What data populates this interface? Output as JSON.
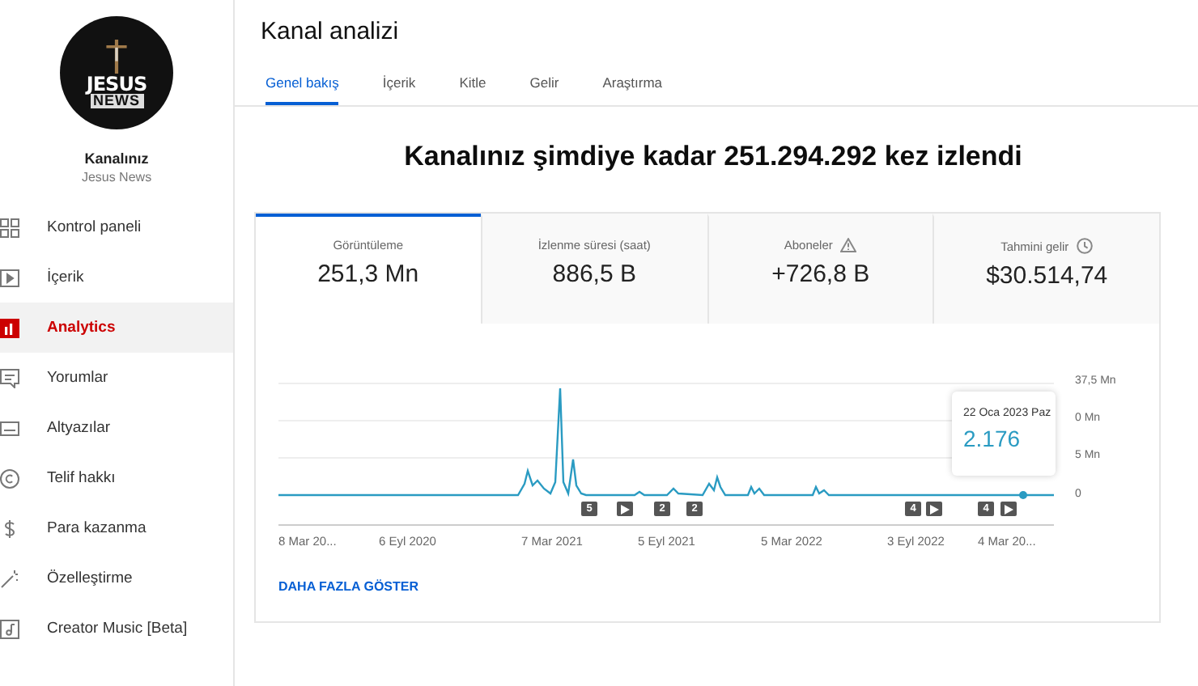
{
  "sidebar": {
    "logo": {
      "line1": "JESUS",
      "line2": "NEWS"
    },
    "channel_label": "Kanalınız",
    "channel_name": "Jesus News",
    "items": [
      {
        "label": "Kontrol paneli",
        "kind": "dashboard",
        "selected": false
      },
      {
        "label": "İçerik",
        "kind": "content",
        "selected": false
      },
      {
        "label": "Analytics",
        "kind": "analytics",
        "selected": true
      },
      {
        "label": "Yorumlar",
        "kind": "comments",
        "selected": false
      },
      {
        "label": "Altyazılar",
        "kind": "subtitles",
        "selected": false
      },
      {
        "label": "Telif hakkı",
        "kind": "copyright",
        "selected": false
      },
      {
        "label": "Para kazanma",
        "kind": "money",
        "selected": false
      },
      {
        "label": "Özelleştirme",
        "kind": "customize",
        "selected": false
      },
      {
        "label": "Creator Music [Beta]",
        "kind": "music",
        "selected": false
      }
    ]
  },
  "header": {
    "title": "Kanal analizi"
  },
  "tabs": [
    {
      "label": "Genel bakış",
      "selected": true
    },
    {
      "label": "İçerik",
      "selected": false
    },
    {
      "label": "Kitle",
      "selected": false
    },
    {
      "label": "Gelir",
      "selected": false
    },
    {
      "label": "Araştırma",
      "selected": false
    }
  ],
  "headline": "Kanalınız şimdiye kadar 251.294.292 kez izlendi",
  "metrics": [
    {
      "label": "Görüntüleme",
      "value": "251,3 Mn",
      "selected": true,
      "kind": "plain"
    },
    {
      "label": "İzlenme süresi (saat)",
      "value": "886,5 B",
      "selected": false,
      "kind": "plain"
    },
    {
      "label": "Aboneler",
      "value": "+726,8 B",
      "selected": false,
      "kind": "warning"
    },
    {
      "label": "Tahmini gelir",
      "value": "$30.514,74",
      "selected": false,
      "kind": "estimate"
    }
  ],
  "chart": {
    "y_labels": [
      "37,5 Mn",
      "0 Mn",
      "5 Mn",
      "0"
    ],
    "x_labels": [
      "8 Mar 20...",
      "6 Eyl 2020",
      "7 Mar 2021",
      "5 Eyl 2021",
      "5 Mar 2022",
      "3 Eyl 2022",
      "4 Mar 20..."
    ],
    "markers": [
      {
        "kind": "count",
        "text": "5"
      },
      {
        "kind": "video"
      },
      {
        "kind": "count",
        "text": "2"
      },
      {
        "kind": "count",
        "text": "2"
      },
      {
        "kind": "count",
        "text": "4"
      },
      {
        "kind": "video"
      },
      {
        "kind": "count",
        "text": "4"
      },
      {
        "kind": "video"
      }
    ],
    "tooltip": {
      "date": "22 Oca 2023 Paz",
      "value": "2.176"
    }
  },
  "show_more": "DAHA FAZLA GÖSTER"
}
